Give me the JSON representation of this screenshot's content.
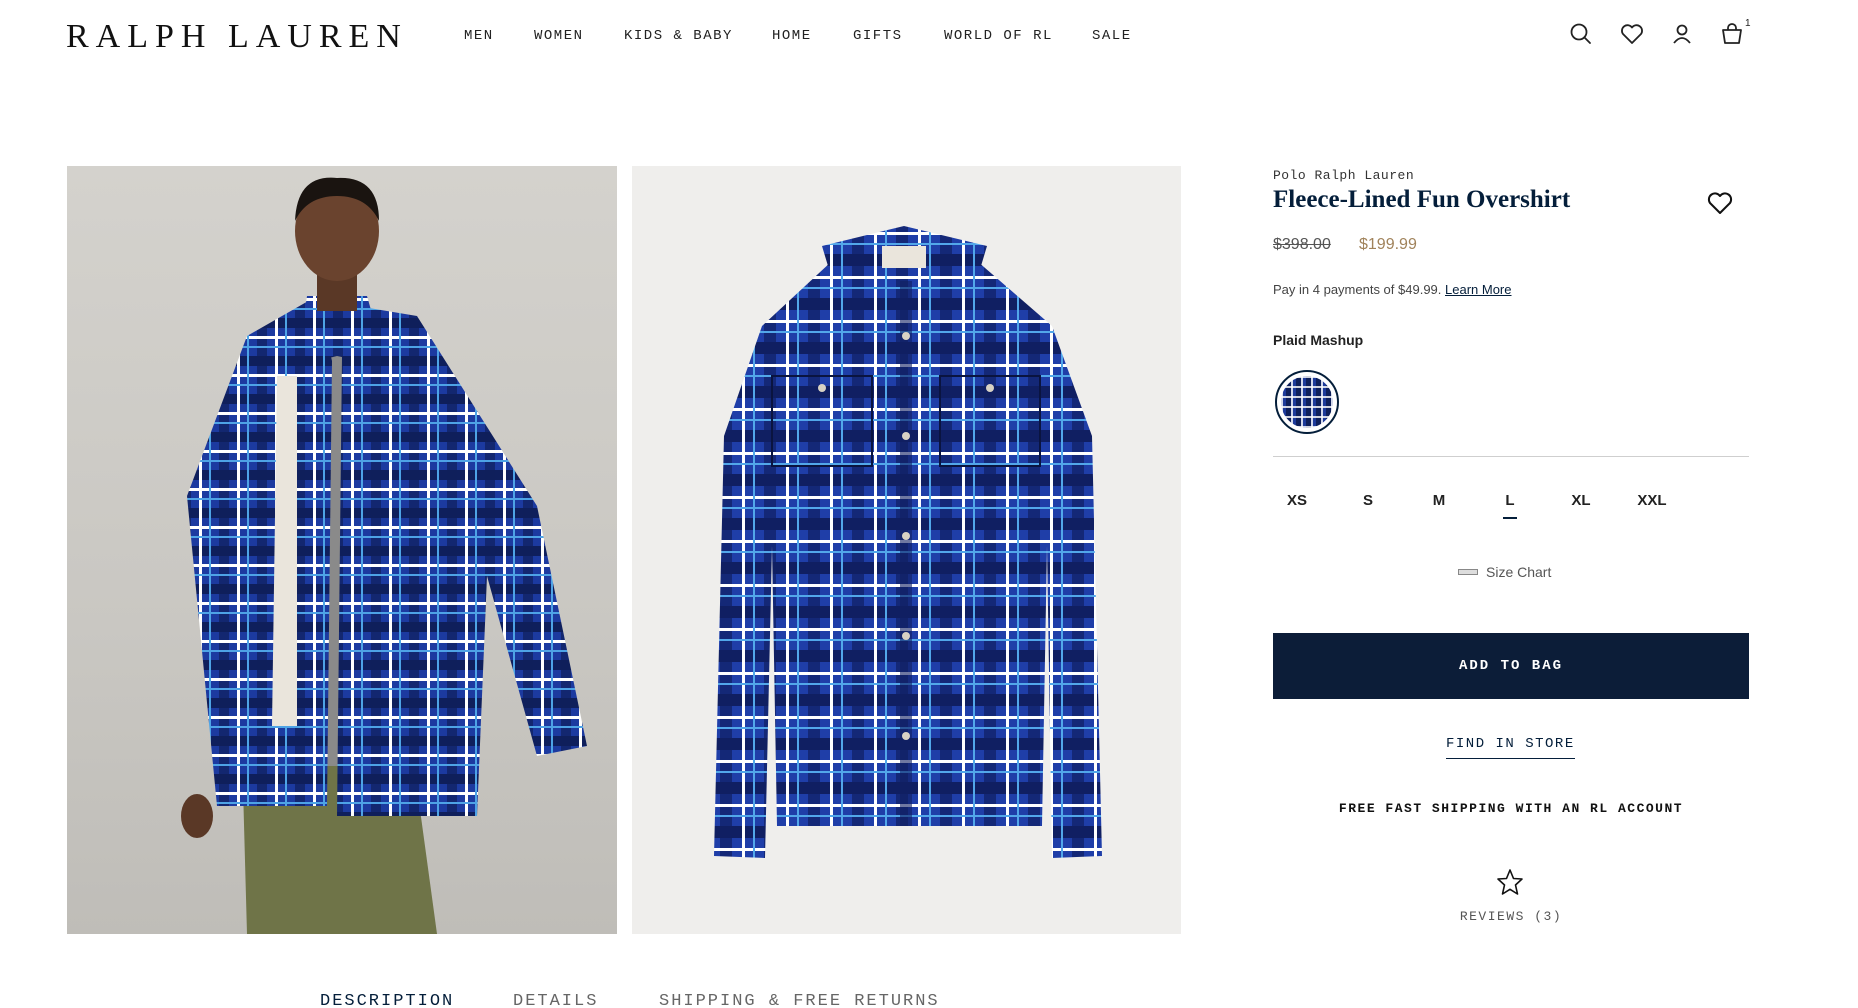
{
  "header": {
    "logo": "RALPH LAUREN",
    "nav": [
      "MEN",
      "WOMEN",
      "KIDS & BABY",
      "HOME",
      "GIFTS",
      "WORLD OF RL",
      "SALE"
    ],
    "cart_count": "1",
    "icons": [
      "search-icon",
      "heart-icon",
      "account-icon",
      "bag-icon"
    ]
  },
  "product": {
    "brand": "Polo Ralph Lauren",
    "title": "Fleece-Lined Fun Overshirt",
    "price_original": "$398.00",
    "price_sale": "$199.99",
    "payment_text": "Pay in 4 payments of $49.99.",
    "learn_more": "Learn More",
    "color_name": "Plaid Mashup",
    "sizes": [
      "XS",
      "S",
      "M",
      "L",
      "XL",
      "XXL"
    ],
    "selected_size": "L",
    "size_chart": "Size Chart",
    "add_to_bag": "ADD TO BAG",
    "find_in_store": "FIND IN STORE",
    "shipping_promo": "FREE FAST SHIPPING WITH AN RL ACCOUNT",
    "reviews": "REVIEWS (3)"
  },
  "tabs": [
    "DESCRIPTION",
    "DETAILS",
    "SHIPPING & FREE RETURNS"
  ],
  "active_tab": "DESCRIPTION",
  "colors": {
    "navy": "#041e3a",
    "button": "#0c1d38",
    "sale_price": "#a0825a",
    "plaid_blue": "#1d3a9a"
  }
}
